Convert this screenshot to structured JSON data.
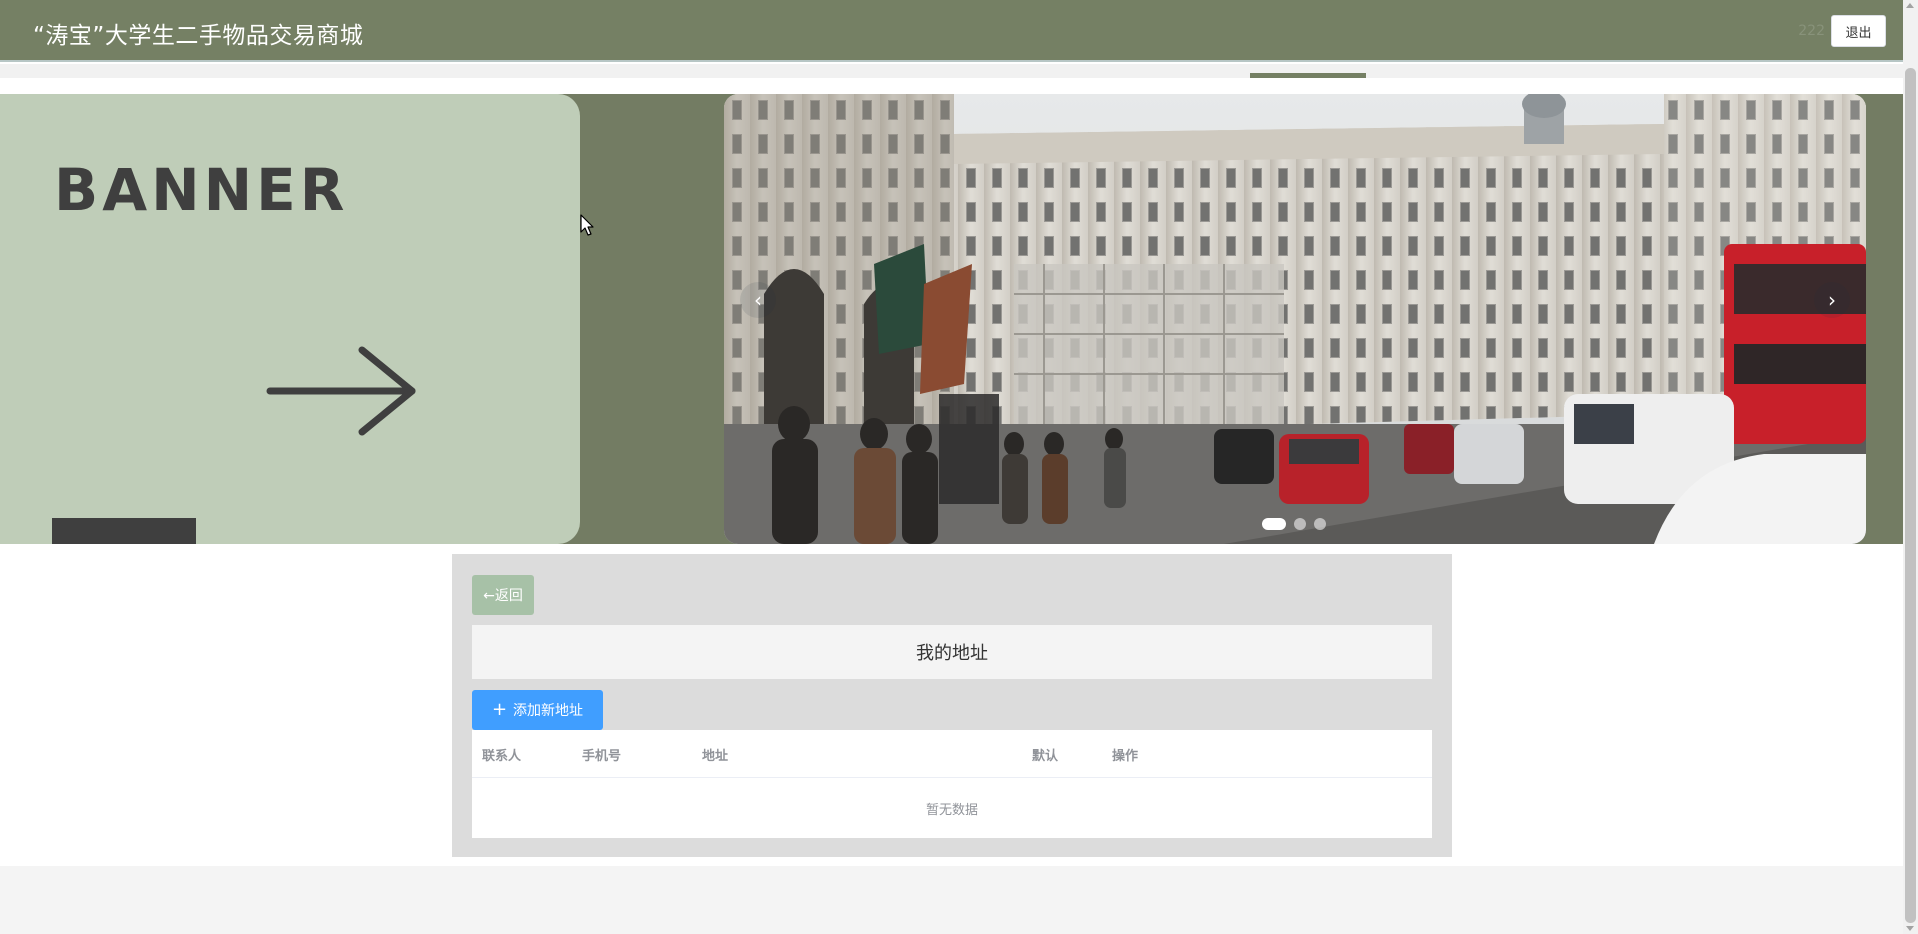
{
  "header": {
    "site_title": "“涛宝”大学生二手物品交易商城",
    "username": "222",
    "logout_label": "退出"
  },
  "carousel": {
    "banner_text": "BANNER",
    "prev_icon": "‹",
    "next_icon": "›",
    "slide_count": 3,
    "active_index": 0
  },
  "address_page": {
    "back_label": "←返回",
    "title": "我的地址",
    "add_label": "添加新地址",
    "table": {
      "columns": [
        "联系人",
        "手机号",
        "地址",
        "默认",
        "操作"
      ],
      "empty_text": "暂无数据"
    }
  },
  "colors": {
    "header_bg": "#758064",
    "banner_bg": "#bfcdb8",
    "back_button": "#a7c1a7",
    "primary": "#409eff"
  }
}
